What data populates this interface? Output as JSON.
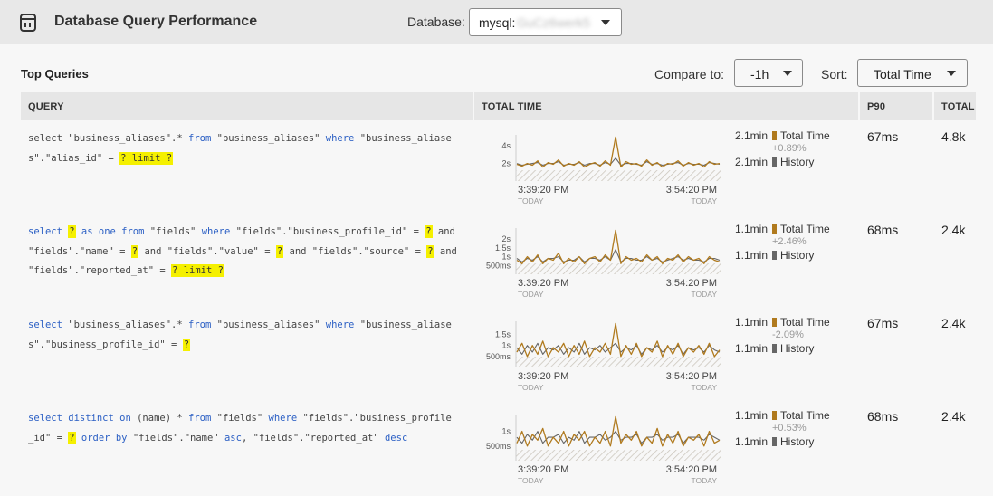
{
  "header": {
    "title": "Database Query Performance",
    "database_label": "Database:",
    "database_prefix": "mysql:",
    "database_hidden": "GuCz6werk5"
  },
  "toolbar": {
    "section_title": "Top Queries",
    "compare_label": "Compare to:",
    "compare_value": "-1h",
    "sort_label": "Sort:",
    "sort_value": "Total Time"
  },
  "table": {
    "columns": [
      "QUERY",
      "TOTAL TIME",
      "P90",
      "TOTAL"
    ]
  },
  "legend": {
    "total_time": "Total Time",
    "history": "History"
  },
  "colors": {
    "total_time": "#b07a1e",
    "history": "#666666",
    "placeholder_highlight": "#f5f000",
    "keyword": "#2b5fc4"
  },
  "rows": [
    {
      "query_lines": [
        [
          [
            "t",
            "select "
          ],
          [
            "t",
            "\"business_aliases\".* "
          ],
          [
            "kw",
            "from "
          ],
          [
            "t",
            "\"business_aliases\" "
          ],
          [
            "kw",
            "where "
          ],
          [
            "t",
            "\"business_aliase"
          ]
        ],
        [
          [
            "t",
            "s\".\"alias_id\" = "
          ],
          [
            "ph",
            "? limit ?"
          ]
        ]
      ],
      "total_time": "2.1min",
      "delta": "+0.89%",
      "history": "2.1min",
      "p90": "67ms",
      "total": "4.8k",
      "y_ticks": [
        "4s",
        "2s"
      ],
      "x_ticks": [
        "3:39:20 PM",
        "3:54:20 PM"
      ],
      "x_sub": [
        "TODAY",
        "TODAY"
      ],
      "series": {
        "total_time": [
          1.9,
          1.7,
          2.0,
          1.8,
          2.3,
          1.6,
          2.1,
          1.9,
          2.4,
          1.7,
          2.0,
          1.8,
          2.2,
          1.6,
          1.9,
          2.1,
          1.7,
          2.3,
          1.8,
          5.0,
          1.6,
          2.2,
          1.9,
          2.0,
          1.7,
          2.4,
          1.8,
          2.1,
          1.6,
          2.0,
          1.9,
          2.3,
          1.7,
          2.1,
          1.8,
          2.0,
          1.6,
          2.2,
          1.9,
          2.0
        ],
        "history": [
          2.0,
          1.8,
          1.9,
          2.0,
          2.1,
          1.8,
          2.0,
          2.0,
          2.2,
          1.8,
          1.9,
          1.9,
          2.1,
          1.8,
          2.0,
          2.0,
          1.8,
          2.1,
          1.9,
          2.6,
          1.8,
          2.0,
          2.0,
          1.9,
          1.8,
          2.2,
          1.9,
          2.0,
          1.8,
          1.9,
          2.0,
          2.1,
          1.8,
          2.0,
          1.9,
          1.9,
          1.8,
          2.1,
          2.0,
          1.9
        ]
      }
    },
    {
      "query_lines": [
        [
          [
            "kw",
            "select "
          ],
          [
            "ph",
            "?"
          ],
          [
            "kw",
            " as one from "
          ],
          [
            "t",
            "\"fields\" "
          ],
          [
            "kw",
            "where "
          ],
          [
            "t",
            "\"fields\".\"business_profile_id\" = "
          ],
          [
            "ph",
            "?"
          ],
          [
            "t",
            " and"
          ]
        ],
        [
          [
            "t",
            "\"fields\".\"name\" = "
          ],
          [
            "ph",
            "?"
          ],
          [
            "t",
            " and \"fields\".\"value\" = "
          ],
          [
            "ph",
            "?"
          ],
          [
            "t",
            " and \"fields\".\"source\" = "
          ],
          [
            "ph",
            "?"
          ],
          [
            "t",
            " and"
          ]
        ],
        [
          [
            "t",
            "\"fields\".\"reported_at\" = "
          ],
          [
            "ph",
            "? limit ?"
          ]
        ]
      ],
      "total_time": "1.1min",
      "delta": "+2.46%",
      "history": "1.1min",
      "p90": "68ms",
      "total": "2.4k",
      "y_ticks": [
        "2s",
        "1.5s",
        "1s",
        "500ms"
      ],
      "x_ticks": [
        "3:39:20 PM",
        "3:54:20 PM"
      ],
      "x_sub": [
        "TODAY",
        "TODAY"
      ],
      "series": {
        "total_time": [
          0.8,
          0.6,
          1.0,
          0.7,
          1.1,
          0.6,
          0.9,
          0.8,
          1.2,
          0.6,
          0.9,
          0.7,
          1.0,
          0.6,
          0.9,
          1.0,
          0.7,
          1.1,
          0.8,
          2.5,
          0.6,
          1.0,
          0.8,
          0.9,
          0.7,
          1.1,
          0.8,
          1.0,
          0.6,
          0.9,
          0.8,
          1.1,
          0.7,
          1.0,
          0.8,
          0.9,
          0.6,
          1.0,
          0.8,
          0.7
        ],
        "history": [
          0.9,
          0.7,
          0.9,
          0.8,
          1.0,
          0.7,
          0.9,
          0.9,
          1.0,
          0.7,
          0.8,
          0.8,
          1.0,
          0.7,
          0.9,
          0.9,
          0.8,
          1.0,
          0.8,
          1.4,
          0.7,
          0.9,
          0.9,
          0.8,
          0.8,
          1.0,
          0.8,
          0.9,
          0.7,
          0.8,
          0.9,
          1.0,
          0.8,
          0.9,
          0.8,
          0.8,
          0.7,
          0.9,
          0.9,
          0.8
        ]
      }
    },
    {
      "query_lines": [
        [
          [
            "kw",
            "select "
          ],
          [
            "t",
            "\"business_aliases\".* "
          ],
          [
            "kw",
            "from "
          ],
          [
            "t",
            "\"business_aliases\" "
          ],
          [
            "kw",
            "where "
          ],
          [
            "t",
            "\"business_aliase"
          ]
        ],
        [
          [
            "t",
            "s\".\"business_profile_id\" = "
          ],
          [
            "ph",
            "?"
          ]
        ]
      ],
      "total_time": "1.1min",
      "delta": "-2.09%",
      "history": "1.1min",
      "p90": "67ms",
      "total": "2.4k",
      "y_ticks": [
        "1.5s",
        "1s",
        "500ms"
      ],
      "x_ticks": [
        "3:39:20 PM",
        "3:54:20 PM"
      ],
      "x_sub": [
        "TODAY",
        "TODAY"
      ],
      "series": {
        "total_time": [
          0.7,
          1.1,
          0.5,
          1.0,
          0.6,
          1.2,
          0.5,
          0.9,
          0.7,
          1.1,
          0.5,
          1.0,
          0.6,
          1.2,
          0.5,
          0.9,
          0.7,
          1.1,
          0.6,
          2.0,
          0.5,
          1.0,
          0.6,
          1.1,
          0.5,
          0.9,
          0.7,
          1.2,
          0.5,
          1.0,
          0.6,
          1.1,
          0.5,
          0.9,
          0.7,
          1.0,
          0.6,
          1.1,
          0.5,
          0.8
        ],
        "history": [
          0.9,
          0.6,
          1.0,
          0.7,
          1.1,
          0.6,
          0.9,
          0.8,
          1.0,
          0.6,
          0.9,
          0.7,
          1.1,
          0.6,
          0.9,
          0.8,
          1.0,
          0.7,
          0.9,
          1.1,
          0.7,
          0.9,
          0.8,
          1.0,
          0.6,
          0.9,
          0.8,
          1.0,
          0.7,
          0.9,
          0.8,
          1.0,
          0.6,
          0.9,
          0.8,
          0.9,
          0.7,
          1.0,
          0.8,
          0.7
        ]
      }
    },
    {
      "query_lines": [
        [
          [
            "kw",
            "select distinct on "
          ],
          [
            "t",
            "(name) * "
          ],
          [
            "kw",
            "from "
          ],
          [
            "t",
            "\"fields\" "
          ],
          [
            "kw",
            "where "
          ],
          [
            "t",
            "\"fields\".\"business_profile"
          ]
        ],
        [
          [
            "t",
            "_id\" = "
          ],
          [
            "ph",
            "?"
          ],
          [
            "kw",
            " order by "
          ],
          [
            "t",
            "\"fields\".\"name\" "
          ],
          [
            "kw",
            "asc"
          ],
          [
            "t",
            ", \"fields\".\"reported_at\" "
          ],
          [
            "kw",
            "desc"
          ]
        ]
      ],
      "total_time": "1.1min",
      "delta": "+0.53%",
      "history": "1.1min",
      "p90": "68ms",
      "total": "2.4k",
      "y_ticks": [
        "1s",
        "500ms"
      ],
      "x_ticks": [
        "3:39:20 PM",
        "3:54:20 PM"
      ],
      "x_sub": [
        "TODAY",
        "TODAY"
      ],
      "series": {
        "total_time": [
          0.6,
          1.0,
          0.5,
          0.9,
          0.7,
          1.1,
          0.5,
          0.8,
          0.6,
          1.0,
          0.5,
          0.9,
          0.7,
          1.0,
          0.5,
          0.8,
          0.6,
          1.0,
          0.5,
          1.5,
          0.6,
          0.9,
          0.7,
          1.0,
          0.5,
          0.8,
          0.6,
          1.1,
          0.5,
          0.9,
          0.6,
          1.0,
          0.5,
          0.8,
          0.7,
          0.9,
          0.5,
          1.0,
          0.6,
          0.7
        ],
        "history": [
          0.8,
          0.6,
          0.9,
          0.7,
          1.0,
          0.6,
          0.8,
          0.8,
          0.9,
          0.6,
          0.8,
          0.7,
          1.0,
          0.6,
          0.8,
          0.8,
          0.9,
          0.7,
          0.8,
          1.0,
          0.7,
          0.8,
          0.8,
          0.9,
          0.6,
          0.8,
          0.8,
          0.9,
          0.7,
          0.8,
          0.8,
          0.9,
          0.6,
          0.8,
          0.8,
          0.8,
          0.7,
          0.9,
          0.8,
          0.7
        ]
      }
    }
  ]
}
